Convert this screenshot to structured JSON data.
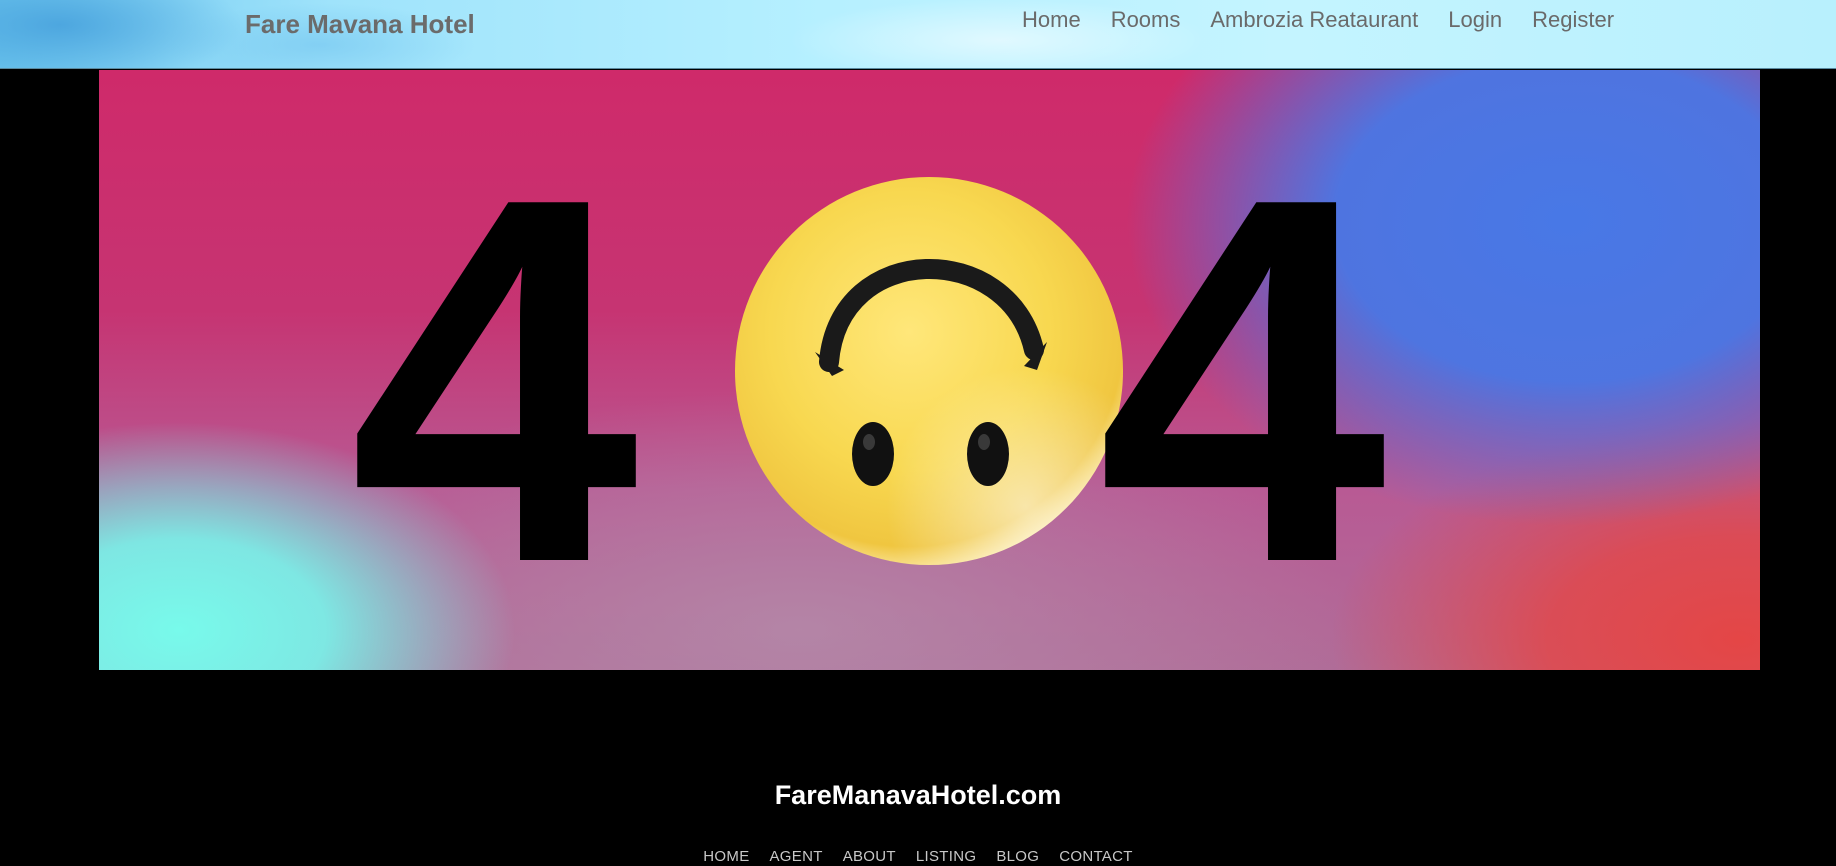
{
  "header": {
    "brand": "Fare Mavana Hotel",
    "nav": [
      {
        "label": "Home"
      },
      {
        "label": "Rooms"
      },
      {
        "label": "Ambrozia Reataurant"
      },
      {
        "label": "Login"
      },
      {
        "label": "Register"
      }
    ]
  },
  "hero": {
    "left_digit": "4",
    "right_digit": "4",
    "center_icon": "upside-down-smiley-face-icon",
    "colors": {
      "magenta": "#cf2a6a",
      "blue": "#4a78e6",
      "cyan": "#78f4ea",
      "red": "#e44646",
      "smiley_yellow": "#f8d850",
      "digit": "#000000"
    }
  },
  "footer": {
    "domain": "FareManavaHotel.com",
    "nav": [
      {
        "label": "HOME"
      },
      {
        "label": "AGENT"
      },
      {
        "label": "ABOUT"
      },
      {
        "label": "LISTING"
      },
      {
        "label": "BLOG"
      },
      {
        "label": "CONTACT"
      }
    ]
  }
}
